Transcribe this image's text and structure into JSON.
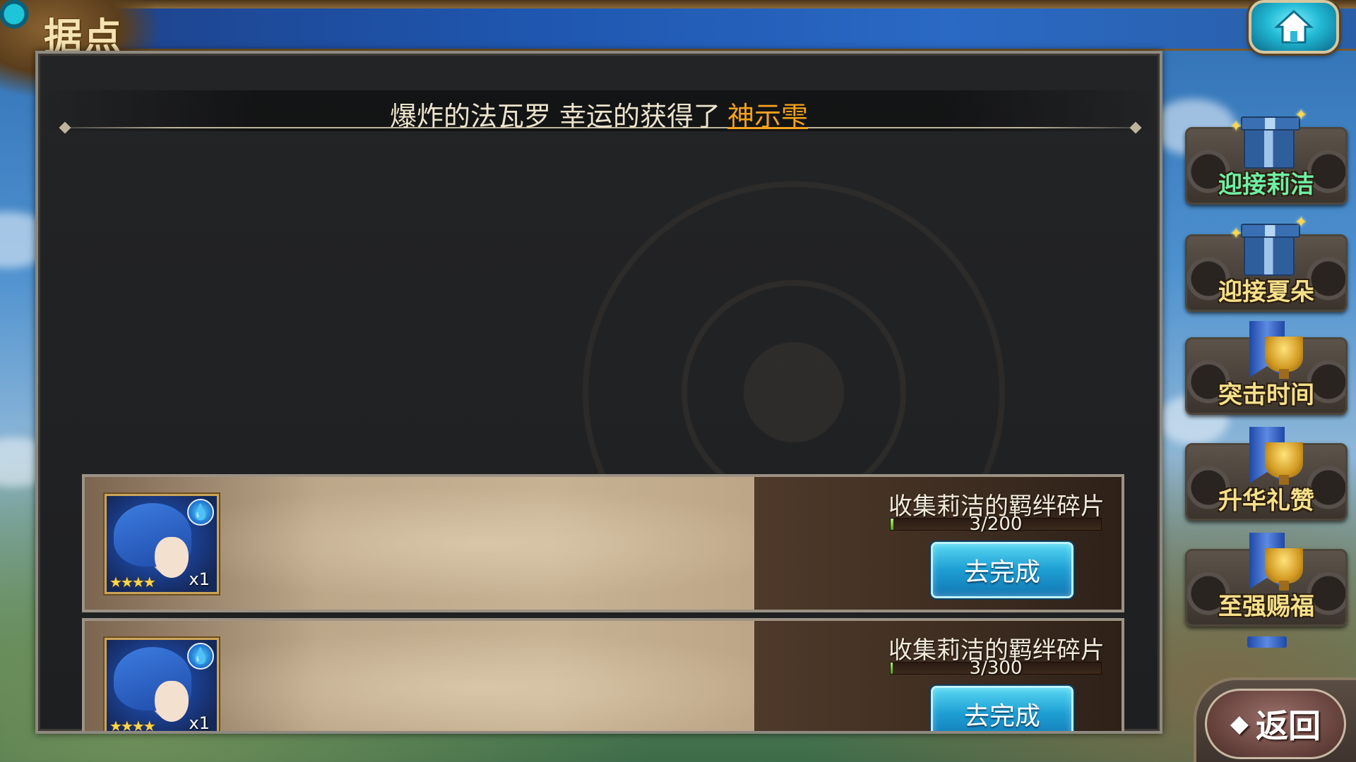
{
  "header": {
    "page_title": "据点",
    "home_icon": "home-icon"
  },
  "announcement": {
    "text": "爆炸的法瓦罗 幸运的获得了",
    "item": "神示雫",
    "item_color": "#f3a21e"
  },
  "tasks": [
    {
      "title": "收集莉洁的羁绊碎片",
      "progress_text": "3/200",
      "progress_fraction": 0.015,
      "quantity": "x1",
      "stars": "★★★★",
      "element_icon": "water-drop-icon",
      "button_label": "去完成"
    },
    {
      "title": "收集莉洁的羁绊碎片",
      "progress_text": "3/300",
      "progress_fraction": 0.01,
      "quantity": "x1",
      "stars": "★★★★",
      "element_icon": "water-drop-icon",
      "button_label": "去完成"
    }
  ],
  "side_menu": {
    "items": [
      {
        "label": "迎接莉洁",
        "icon": "gift-box-icon",
        "label_color": "#6df0a4"
      },
      {
        "label": "迎接夏朵",
        "icon": "gift-box-icon",
        "label_color": "#f5e08a"
      },
      {
        "label": "突击时间",
        "icon": "trophy-icon",
        "label_color": "#f5e08a"
      },
      {
        "label": "升华礼赞",
        "icon": "trophy-icon",
        "label_color": "#f5e08a"
      },
      {
        "label": "至强赐福",
        "icon": "trophy-icon",
        "label_color": "#f5e08a"
      }
    ]
  },
  "back": {
    "label": "返回",
    "icon": "back-arrow-icon"
  }
}
